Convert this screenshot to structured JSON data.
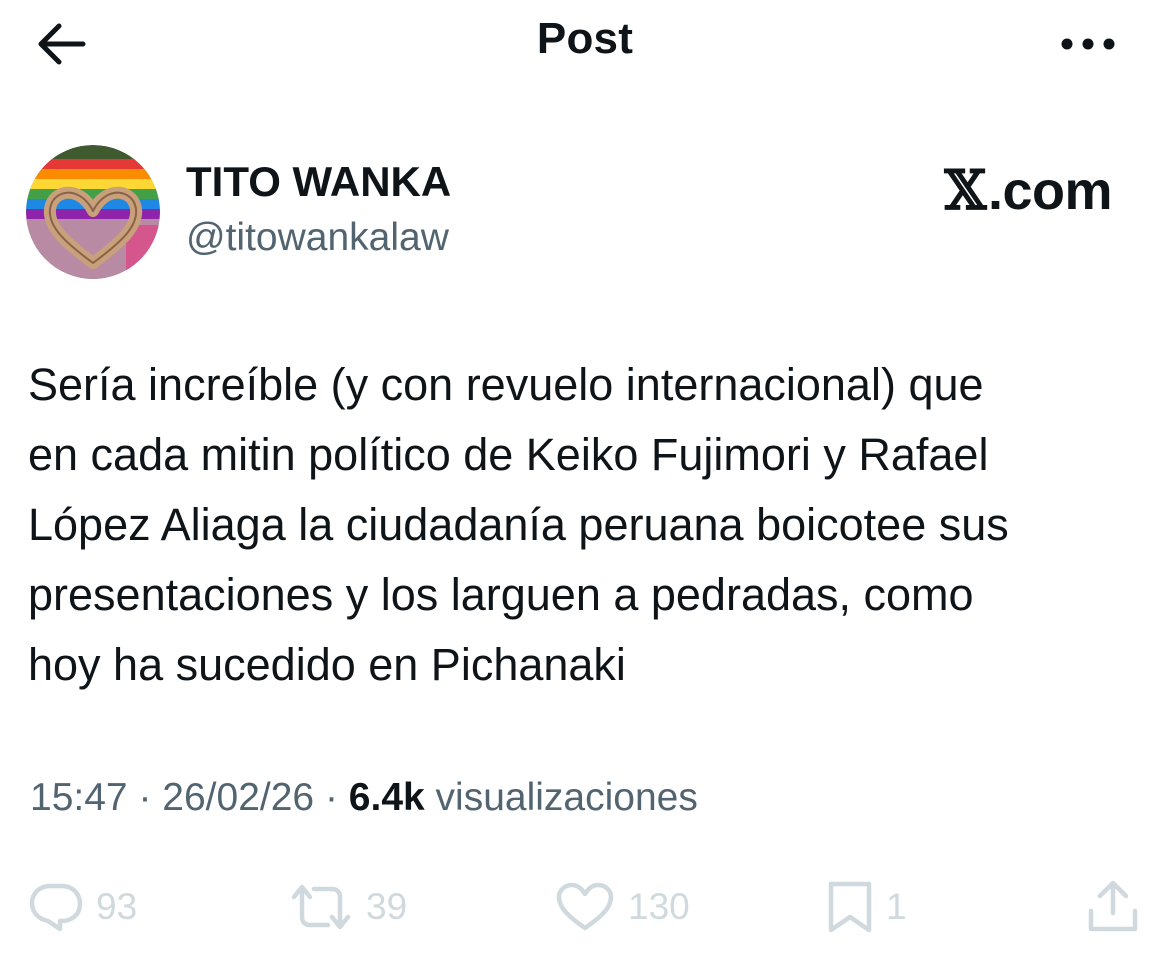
{
  "header": {
    "title": "Post",
    "back_icon": "arrow-left-icon",
    "more_icon": "more-horizontal-icon"
  },
  "author": {
    "name": "TITO WANKA",
    "handle": "@titowankalaw",
    "avatar": "avatar-image"
  },
  "brand": {
    "label": ".com"
  },
  "post": {
    "text": "Sería increíble (y con revuelo internacional) que\nen cada mitin político de Keiko Fujimori y Rafael\nLópez Aliaga la ciudadanía peruana boicotee sus\npresentaciones y los larguen a pedradas, como\nhoy ha sucedido en Pichanaki"
  },
  "meta": {
    "time": "15:47",
    "separator": "·",
    "date": "26/02/26",
    "views_count": "6.4k",
    "views_label": "visualizaciones"
  },
  "actions": {
    "replies": {
      "icon": "reply-icon",
      "count": "93"
    },
    "reposts": {
      "icon": "repost-icon",
      "count": "39"
    },
    "likes": {
      "icon": "heart-icon",
      "count": "130"
    },
    "bookmarks": {
      "icon": "bookmark-icon",
      "count": "1"
    },
    "share": {
      "icon": "share-icon"
    }
  },
  "colors": {
    "text_primary": "#0f1419",
    "text_secondary": "#536471",
    "action_muted": "#cfd9de"
  }
}
